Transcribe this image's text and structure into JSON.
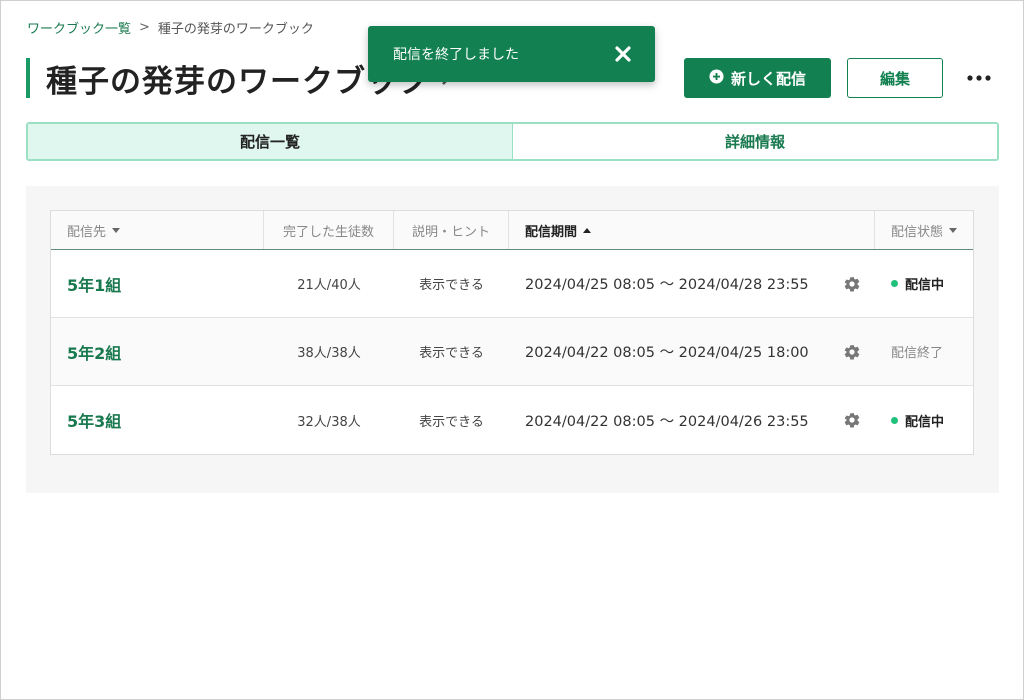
{
  "breadcrumb": {
    "parent": "ワークブック一覧",
    "separator": ">",
    "current": "種子の発芽のワークブック"
  },
  "page": {
    "title": "種子の発芽のワークブック"
  },
  "toast": {
    "message": "配信を終了しました"
  },
  "actions": {
    "new_delivery": "新しく配信",
    "edit": "編集"
  },
  "tabs": [
    {
      "label": "配信一覧",
      "active": true
    },
    {
      "label": "詳細情報",
      "active": false
    }
  ],
  "table": {
    "headers": {
      "destination": "配信先",
      "completed": "完了した生徒数",
      "hint": "説明・ヒント",
      "period": "配信期間",
      "status": "配信状態"
    },
    "rows": [
      {
        "class_name": "5年1組",
        "completed": "21人/40人",
        "hint": "表示できる",
        "period": "2024/04/25 08:05 〜 2024/04/28 23:55",
        "status": "配信中"
      },
      {
        "class_name": "5年2組",
        "completed": "38人/38人",
        "hint": "表示できる",
        "period": "2024/04/22 08:05 〜 2024/04/25 18:00",
        "status": "配信終了"
      },
      {
        "class_name": "5年3組",
        "completed": "32人/38人",
        "hint": "表示できる",
        "period": "2024/04/22 08:05 〜 2024/04/26 23:55",
        "status": "配信中"
      }
    ]
  },
  "colors": {
    "brand": "#128050",
    "tab_active_bg": "#dff7ee",
    "status_dot": "#1fc07a"
  },
  "icons": {
    "toast_close": "close-icon",
    "new": "plus-circle-icon",
    "more": "more-horizontal-icon",
    "settings": "gear-icon"
  }
}
